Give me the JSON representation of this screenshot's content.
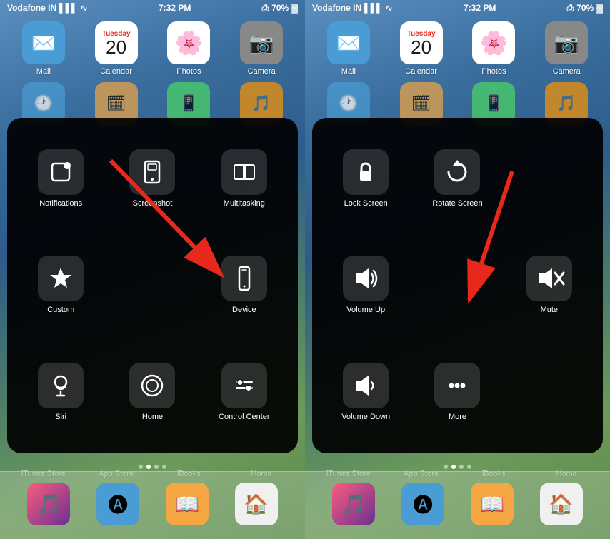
{
  "panels": [
    {
      "id": "left",
      "status": {
        "carrier": "Vodafone IN",
        "time": "7:32 PM",
        "battery": "70%"
      },
      "top_apps": [
        {
          "label": "Mail",
          "icon": "mail",
          "color": "#4a9cd4",
          "emoji": "✉️"
        },
        {
          "label": "Calendar",
          "icon": "calendar",
          "color": "#ffffff",
          "emoji": "📅"
        },
        {
          "label": "Photos",
          "icon": "photos",
          "color": "#ffffff",
          "emoji": "🌸"
        },
        {
          "label": "Camera",
          "icon": "camera",
          "color": "#888888",
          "emoji": "📷"
        }
      ],
      "assist_items": [
        {
          "label": "Notifications",
          "icon": "notification"
        },
        {
          "label": "Screenshot",
          "icon": "screenshot"
        },
        {
          "label": "Multitasking",
          "icon": "multitask"
        },
        {
          "label": "Custom",
          "icon": "star"
        },
        {
          "label": "",
          "icon": ""
        },
        {
          "label": "Device",
          "icon": "device"
        },
        {
          "label": "Siri",
          "icon": "siri"
        },
        {
          "label": "Home",
          "icon": "home"
        },
        {
          "label": "Control Center",
          "icon": "control"
        }
      ],
      "dock": [
        {
          "label": "iTunes Store",
          "icon": "itunes"
        },
        {
          "label": "App Store",
          "icon": "appstore"
        },
        {
          "label": "iBooks",
          "icon": "ibooks"
        },
        {
          "label": "Home",
          "icon": "home-dock"
        }
      ]
    },
    {
      "id": "right",
      "status": {
        "carrier": "Vodafone IN",
        "time": "7:32 PM",
        "battery": "70%"
      },
      "control_items": [
        {
          "label": "Lock\nScreen",
          "icon": "lock"
        },
        {
          "label": "Rotate\nScreen",
          "icon": "rotate"
        },
        {
          "label": "",
          "icon": ""
        },
        {
          "label": "Volume\nUp",
          "icon": "volume-up"
        },
        {
          "label": "",
          "icon": "arrow-left"
        },
        {
          "label": "Mute",
          "icon": "mute"
        },
        {
          "label": "Volume\nDown",
          "icon": "volume-down"
        },
        {
          "label": "More",
          "icon": "more"
        },
        {
          "label": "",
          "icon": ""
        }
      ],
      "dock": [
        {
          "label": "iTunes Store",
          "icon": "itunes"
        },
        {
          "label": "App Store",
          "icon": "appstore"
        },
        {
          "label": "iBooks",
          "icon": "ibooks"
        },
        {
          "label": "Home",
          "icon": "home-dock"
        }
      ]
    }
  ]
}
